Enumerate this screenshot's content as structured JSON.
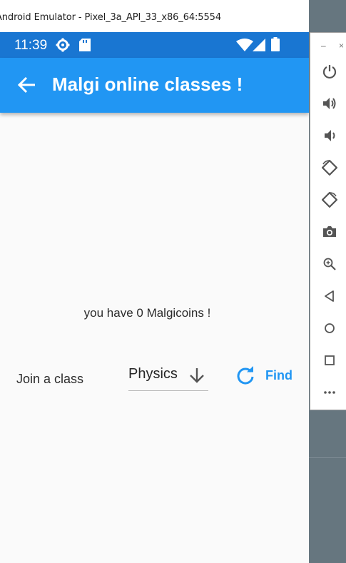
{
  "window": {
    "title": "Android Emulator - Pixel_3a_API_33_x86_64:5554"
  },
  "status_bar": {
    "time": "11:39"
  },
  "app_bar": {
    "title": "Malgi online classes !"
  },
  "main": {
    "coins_text": "you have 0 Malgicoins !",
    "join_label": "Join a class",
    "subject_dropdown": {
      "selected": "Physics"
    },
    "find_button": {
      "label": "Find"
    }
  },
  "side_panel": {
    "minimize": "–",
    "close": "×",
    "buttons": [
      "power-icon",
      "volume-up-icon",
      "volume-down-icon",
      "rotate-left-icon",
      "rotate-right-icon",
      "camera-icon",
      "zoom-icon",
      "back-icon",
      "home-icon",
      "overview-icon",
      "more-icon"
    ]
  },
  "colors": {
    "app_bar": "#2196f3",
    "status_bar": "#1976d2",
    "accent": "#2196f3",
    "background": "#fafafa"
  }
}
